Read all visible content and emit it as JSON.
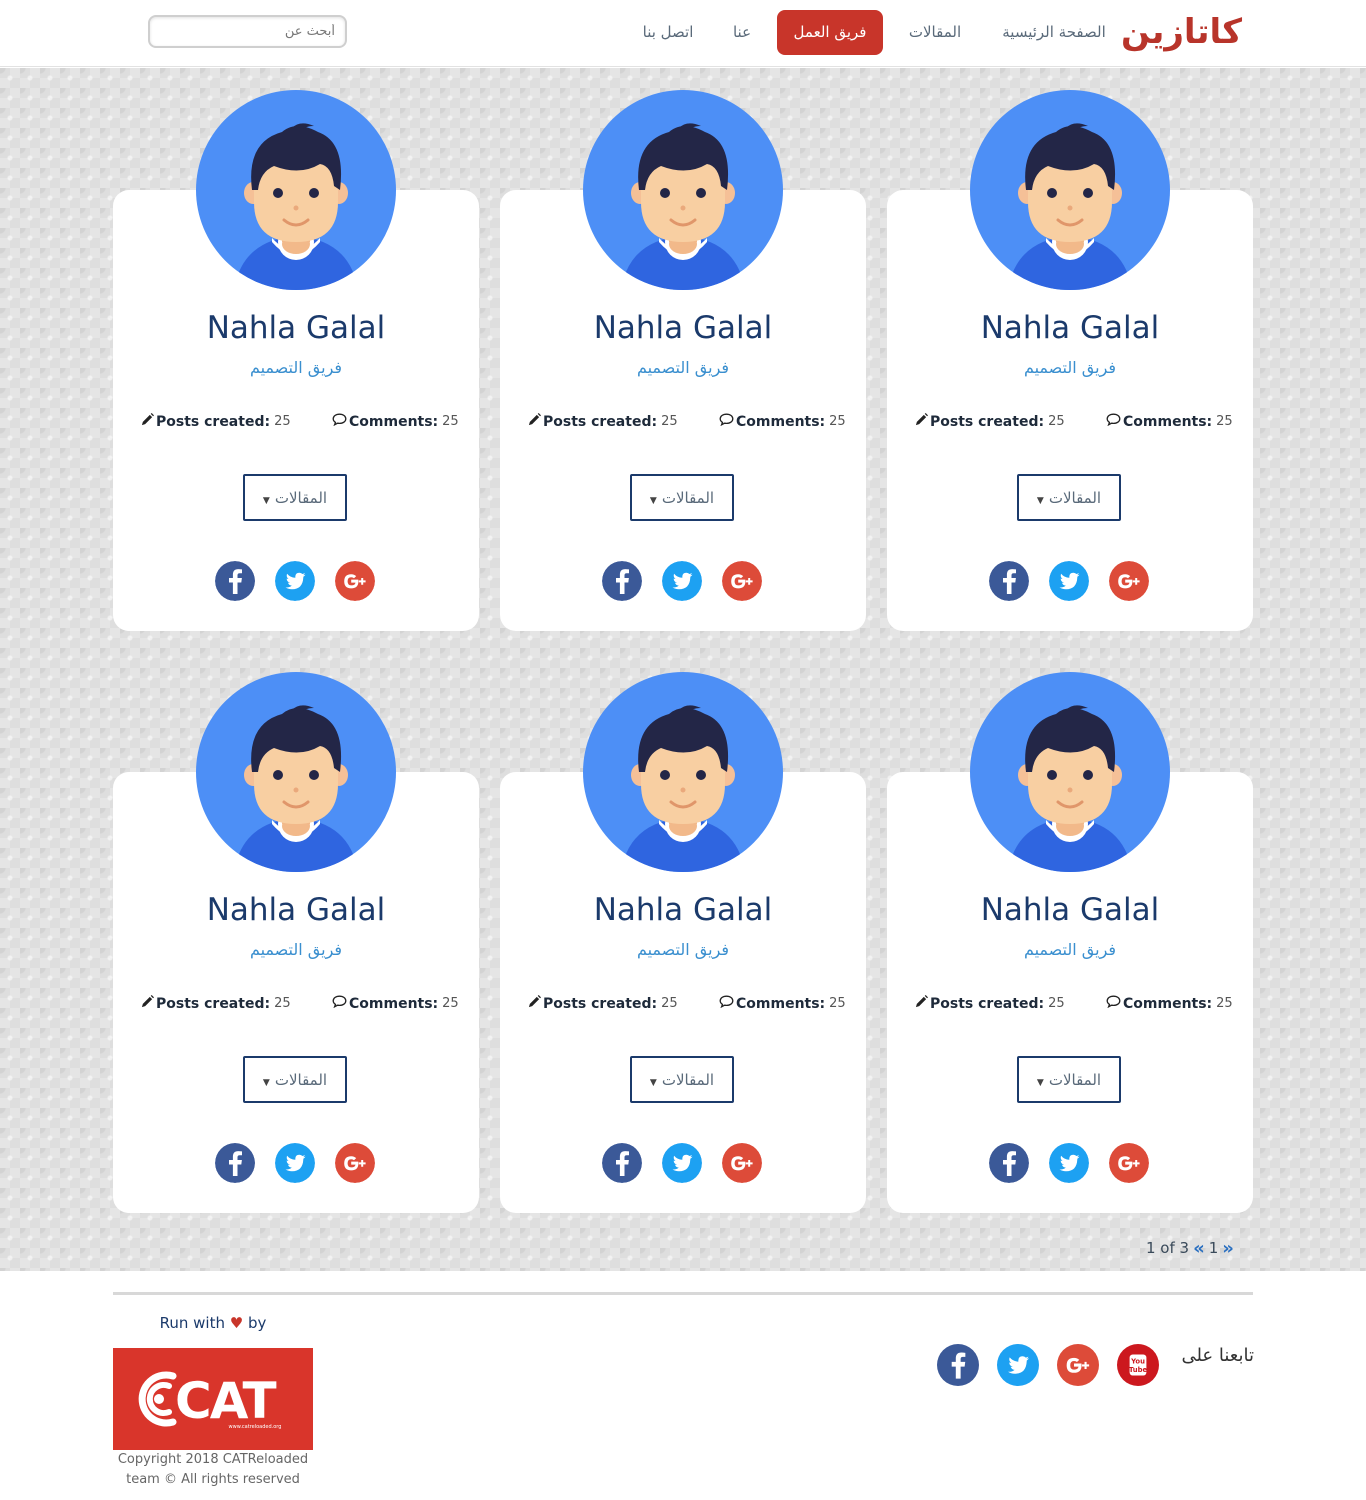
{
  "header": {
    "logo": "كاتازين",
    "nav": {
      "home": "الصفحة الرئيسية",
      "articles": "المقالات",
      "team": "فريق العمل",
      "about": "عنا",
      "contact": "اتصل بنا"
    },
    "search": {
      "placeholder": "أبحث عن",
      "value": ""
    }
  },
  "colors": {
    "brand_red": "#c8352a",
    "navy": "#1b3a6b",
    "avatar_blue": "#4d8ff6",
    "facebook": "#3b5998",
    "twitter": "#1da1f2",
    "google_plus": "#dd4b39",
    "youtube": "#cc181e"
  },
  "team": {
    "members": [
      {
        "name": "Nahla Galal",
        "role": "فريق التصميم",
        "posts_label": "Posts created:",
        "posts": "25",
        "comments_label": "Comments:",
        "comments": "25",
        "articles_button": "المقالات"
      },
      {
        "name": "Nahla Galal",
        "role": "فريق التصميم",
        "posts_label": "Posts created:",
        "posts": "25",
        "comments_label": "Comments:",
        "comments": "25",
        "articles_button": "المقالات"
      },
      {
        "name": "Nahla Galal",
        "role": "فريق التصميم",
        "posts_label": "Posts created:",
        "posts": "25",
        "comments_label": "Comments:",
        "comments": "25",
        "articles_button": "المقالات"
      },
      {
        "name": "Nahla Galal",
        "role": "فريق التصميم",
        "posts_label": "Posts created:",
        "posts": "25",
        "comments_label": "Comments:",
        "comments": "25",
        "articles_button": "المقالات"
      },
      {
        "name": "Nahla Galal",
        "role": "فريق التصميم",
        "posts_label": "Posts created:",
        "posts": "25",
        "comments_label": "Comments:",
        "comments": "25",
        "articles_button": "المقالات"
      },
      {
        "name": "Nahla Galal",
        "role": "فريق التصميم",
        "posts_label": "Posts created:",
        "posts": "25",
        "comments_label": "Comments:",
        "comments": "25",
        "articles_button": "المقالات"
      }
    ],
    "social_icons": [
      "facebook-icon",
      "twitter-icon",
      "google-plus-icon"
    ]
  },
  "pagination": {
    "current": "1",
    "text": "1 of 3",
    "prev_icon": "double-chevron-left-icon",
    "next_icon": "double-chevron-right-icon"
  },
  "footer": {
    "run_with_prefix": "Run with",
    "heart": "♥",
    "run_with_suffix": "by",
    "logo_text": "@CAT",
    "logo_url_text": "www.catreloaded.org",
    "copyright_line1": "Copyright 2018 CATReloaded",
    "copyright_line2": "team © All rights reserved",
    "follow_label": "تابعنا على",
    "social_icons": [
      "youtube-icon",
      "google-plus-icon",
      "twitter-icon",
      "facebook-icon"
    ]
  }
}
